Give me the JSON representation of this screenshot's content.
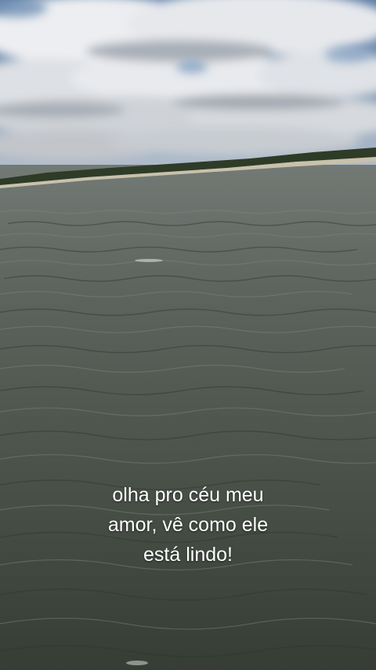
{
  "caption": {
    "line1": "olha pro céu meu",
    "line2": "amor, vê como ele",
    "line3": "está lindo!"
  },
  "colors": {
    "sky_blue": "#6f8fb3",
    "cloud": "#e9ebee",
    "cloud_shadow": "#a9adb3",
    "treeline": "#2f3d28",
    "sand": "#c9c2ad",
    "water_far": "#6e746f",
    "water_mid": "#555c55",
    "water_near": "#3a4239",
    "caption_text": "#ffffff"
  }
}
